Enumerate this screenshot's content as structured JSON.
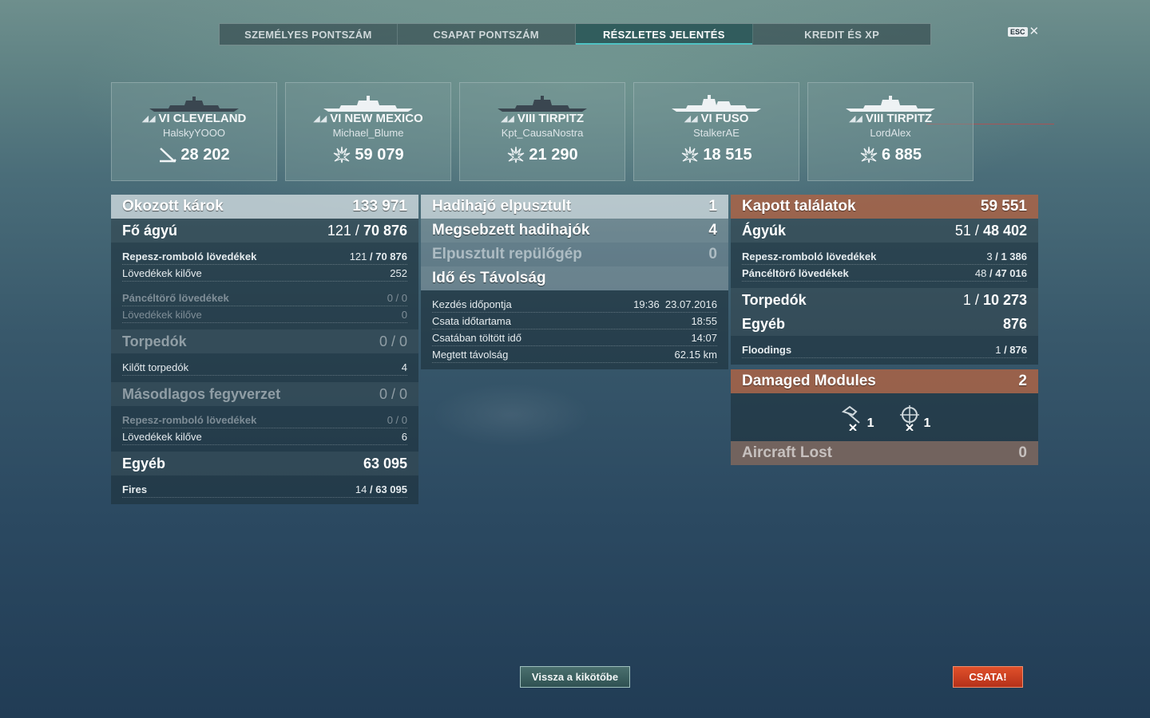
{
  "tabs": [
    "SZEMÉLYES PONTSZÁM",
    "CSAPAT PONTSZÁM",
    "RÉSZLETES JELENTÉS",
    "KREDIT ÉS XP"
  ],
  "esc_label": "ESC",
  "ships": [
    {
      "tier": "VI",
      "name": "CLEVELAND",
      "player": "HalskyYOOO",
      "score": "28 202",
      "icon": "ship-sunk-icon"
    },
    {
      "tier": "VI",
      "name": "NEW MEXICO",
      "player": "Michael_Blume",
      "score": "59 079",
      "icon": "damage-icon"
    },
    {
      "tier": "VIII",
      "name": "TIRPITZ",
      "player": "Kpt_CausaNostra",
      "score": "21 290",
      "icon": "damage-icon"
    },
    {
      "tier": "VI",
      "name": "FUSO",
      "player": "StalkerAE",
      "score": "18 515",
      "icon": "damage-icon"
    },
    {
      "tier": "VIII",
      "name": "TIRPITZ",
      "player": "LordAlex",
      "score": "6 885",
      "icon": "damage-icon"
    }
  ],
  "col1": {
    "damage": {
      "label": "Okozott károk",
      "value": "133 971"
    },
    "main_guns": {
      "label": "Fő ágyú",
      "hits": "121",
      "total": "70 876"
    },
    "he": {
      "label": "Repesz-romboló lövedékek",
      "hits": "121",
      "total": "70 876"
    },
    "he_fired": {
      "label": "Lövedékek kilőve",
      "value": "252"
    },
    "ap": {
      "label": "Páncéltörő lövedékek",
      "value": "0 / 0"
    },
    "ap_fired": {
      "label": "Lövedékek kilőve",
      "value": "0"
    },
    "torpedoes": {
      "label": "Torpedók",
      "value": "0 / 0"
    },
    "torp_fired": {
      "label": "Kilőtt torpedók",
      "value": "4"
    },
    "secondary": {
      "label": "Másodlagos fegyverzet",
      "value": "0 / 0"
    },
    "sec_he": {
      "label": "Repesz-romboló lövedékek",
      "value": "0 / 0"
    },
    "sec_fired": {
      "label": "Lövedékek kilőve",
      "value": "6"
    },
    "other": {
      "label": "Egyéb",
      "value": "63 095"
    },
    "fires": {
      "label": "Fires",
      "hits": "14",
      "total": "63 095"
    }
  },
  "col2": {
    "destroyed": {
      "label": "Hadihajó elpusztult",
      "value": "1"
    },
    "damaged": {
      "label": "Megsebzett hadihajók",
      "value": "4"
    },
    "planes": {
      "label": "Elpusztult repülőgép",
      "value": "0"
    },
    "time_header": "Idő és Távolság",
    "start": {
      "label": "Kezdés időpontja",
      "value": "19:36  23.07.2016"
    },
    "duration": {
      "label": "Csata időtartama",
      "value": "18:55"
    },
    "time_in_battle": {
      "label": "Csatában töltött idő",
      "value": "14:07"
    },
    "distance": {
      "label": "Megtett távolság",
      "value": "62.15 km"
    }
  },
  "col3": {
    "received": {
      "label": "Kapott találatok",
      "value": "59 551"
    },
    "guns": {
      "label": "Ágyúk",
      "hits": "51",
      "total": "48 402"
    },
    "he": {
      "label": "Repesz-romboló lövedékek",
      "hits": "3",
      "total": "1 386"
    },
    "ap": {
      "label": "Páncéltörő lövedékek",
      "hits": "48",
      "total": "47 016"
    },
    "torpedoes": {
      "label": "Torpedók",
      "hits": "1",
      "total": "10 273"
    },
    "other": {
      "label": "Egyéb",
      "value": "876"
    },
    "floodings": {
      "label": "Floodings",
      "hits": "1",
      "total": "876"
    },
    "modules": {
      "label": "Damaged Modules",
      "value": "2"
    },
    "module_items": [
      {
        "icon": "turret-icon",
        "count": "1"
      },
      {
        "icon": "steering-icon",
        "count": "1"
      }
    ],
    "aircraft_lost": {
      "label": "Aircraft Lost",
      "value": "0"
    }
  },
  "buttons": {
    "back": "Vissza a kikötőbe",
    "battle": "CSATA!"
  }
}
